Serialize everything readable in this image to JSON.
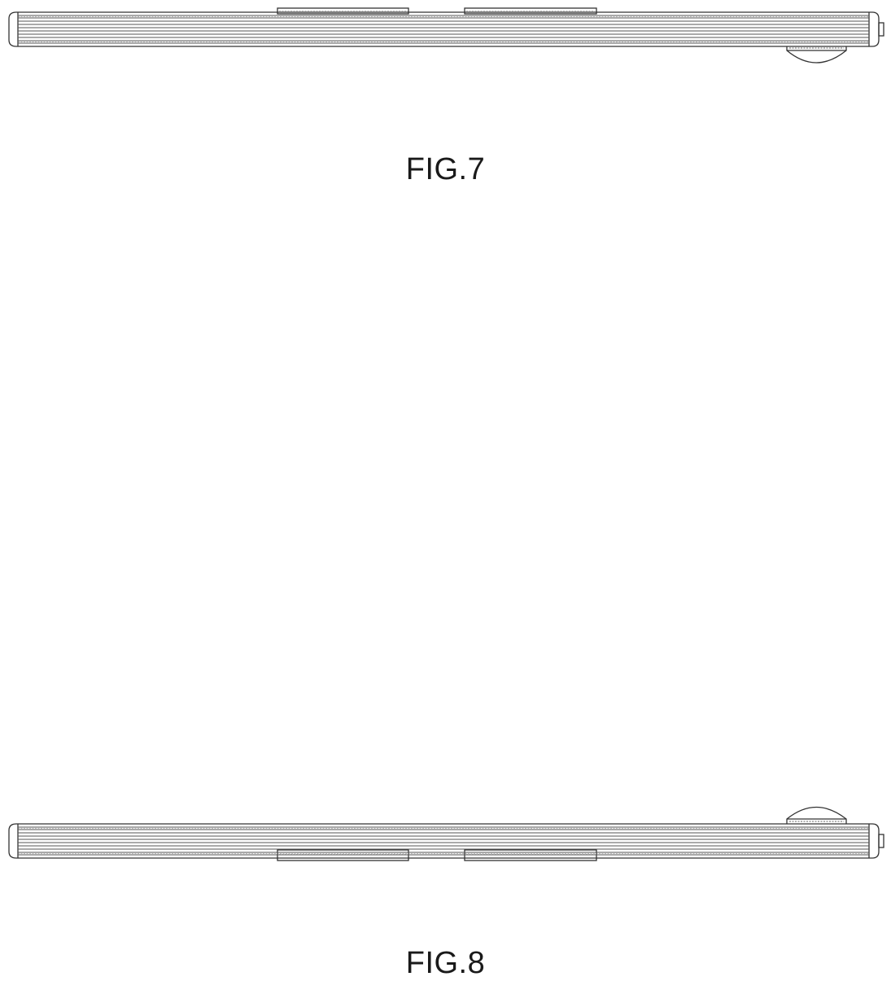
{
  "figures": [
    {
      "caption": "FIG.7"
    },
    {
      "caption": "FIG.8"
    }
  ]
}
